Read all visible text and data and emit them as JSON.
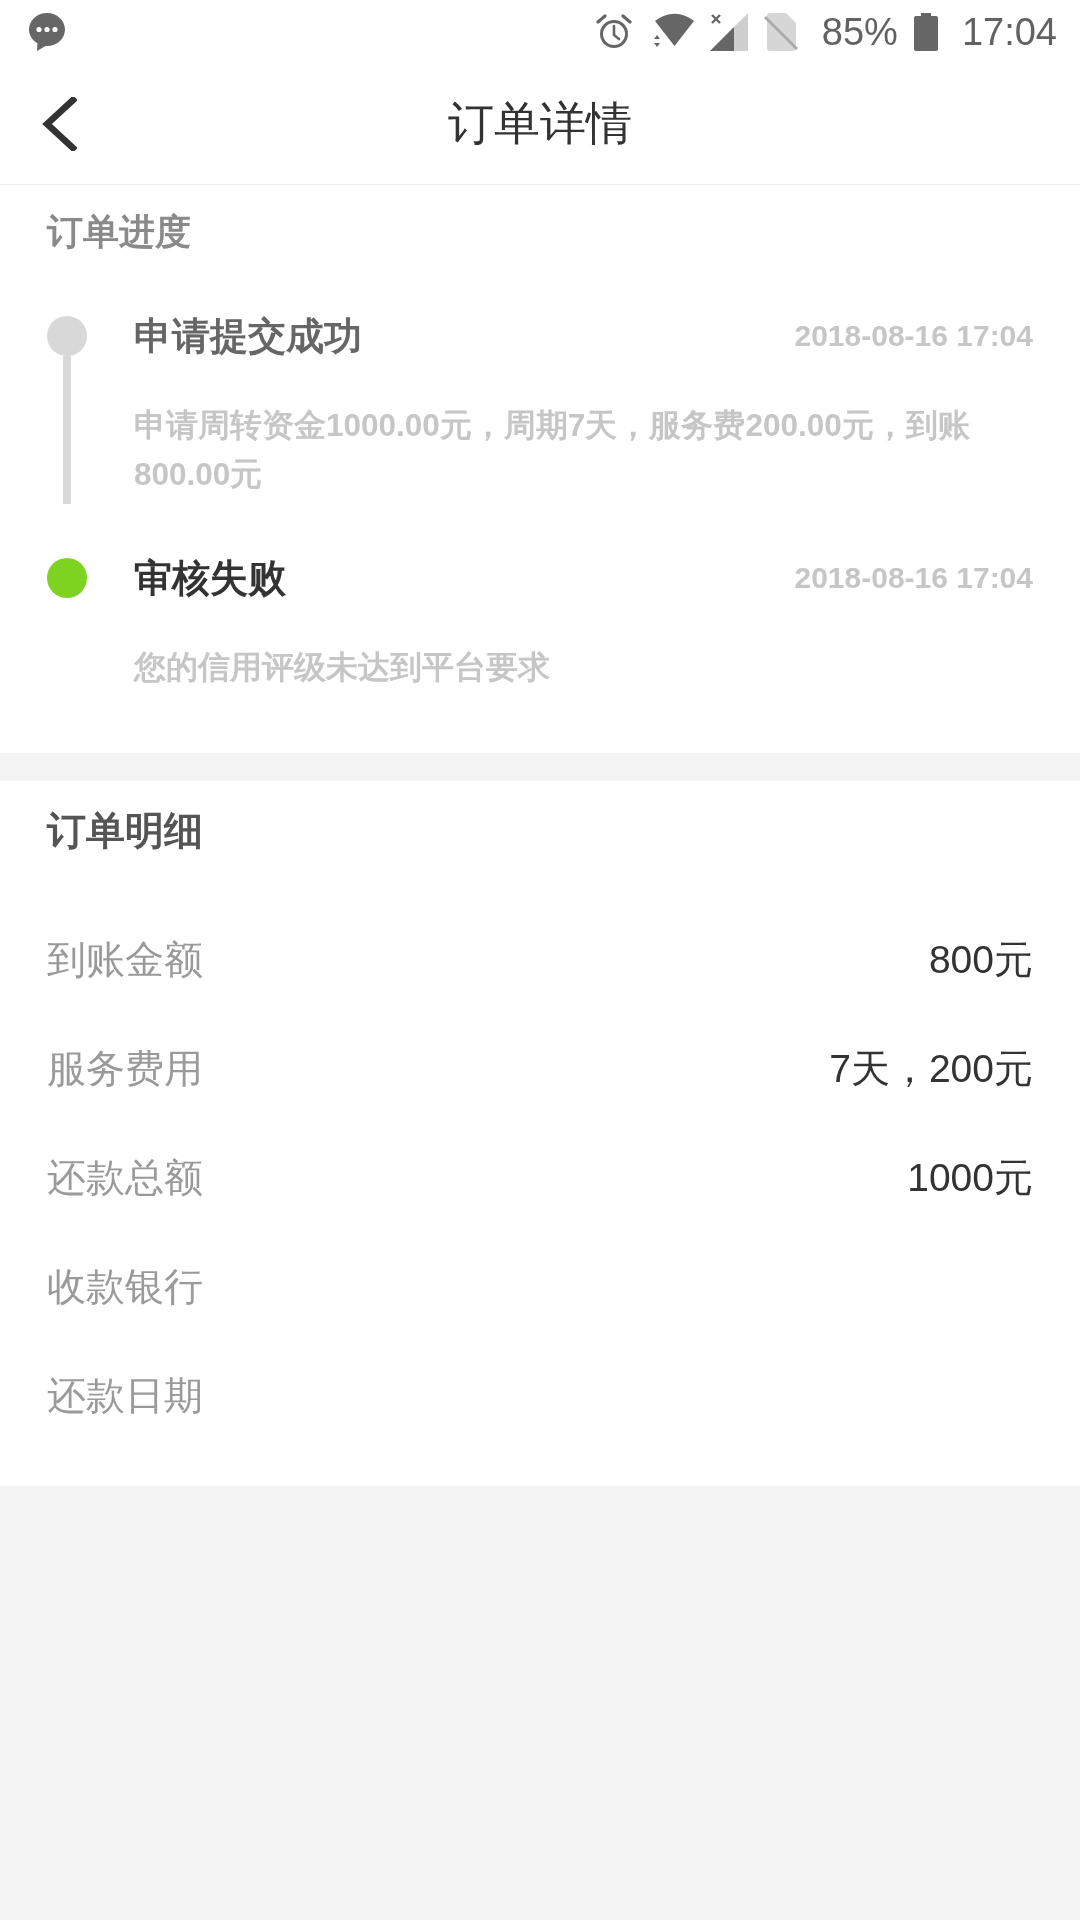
{
  "status_bar": {
    "battery": "85%",
    "time": "17:04"
  },
  "header": {
    "title": "订单详情"
  },
  "progress": {
    "title": "订单进度",
    "steps": [
      {
        "title": "申请提交成功",
        "time": "2018-08-16 17:04",
        "description": "申请周转资金1000.00元，周期7天，服务费200.00元，到账800.00元",
        "current": false
      },
      {
        "title": "审核失败",
        "time": "2018-08-16 17:04",
        "description": "您的信用评级未达到平台要求",
        "current": true
      }
    ]
  },
  "details": {
    "title": "订单明细",
    "rows": [
      {
        "label": "到账金额",
        "value": "800元"
      },
      {
        "label": "服务费用",
        "value": "7天，200元"
      },
      {
        "label": "还款总额",
        "value": "1000元"
      },
      {
        "label": "收款银行"
      },
      {
        "label": "还款日期"
      }
    ]
  }
}
